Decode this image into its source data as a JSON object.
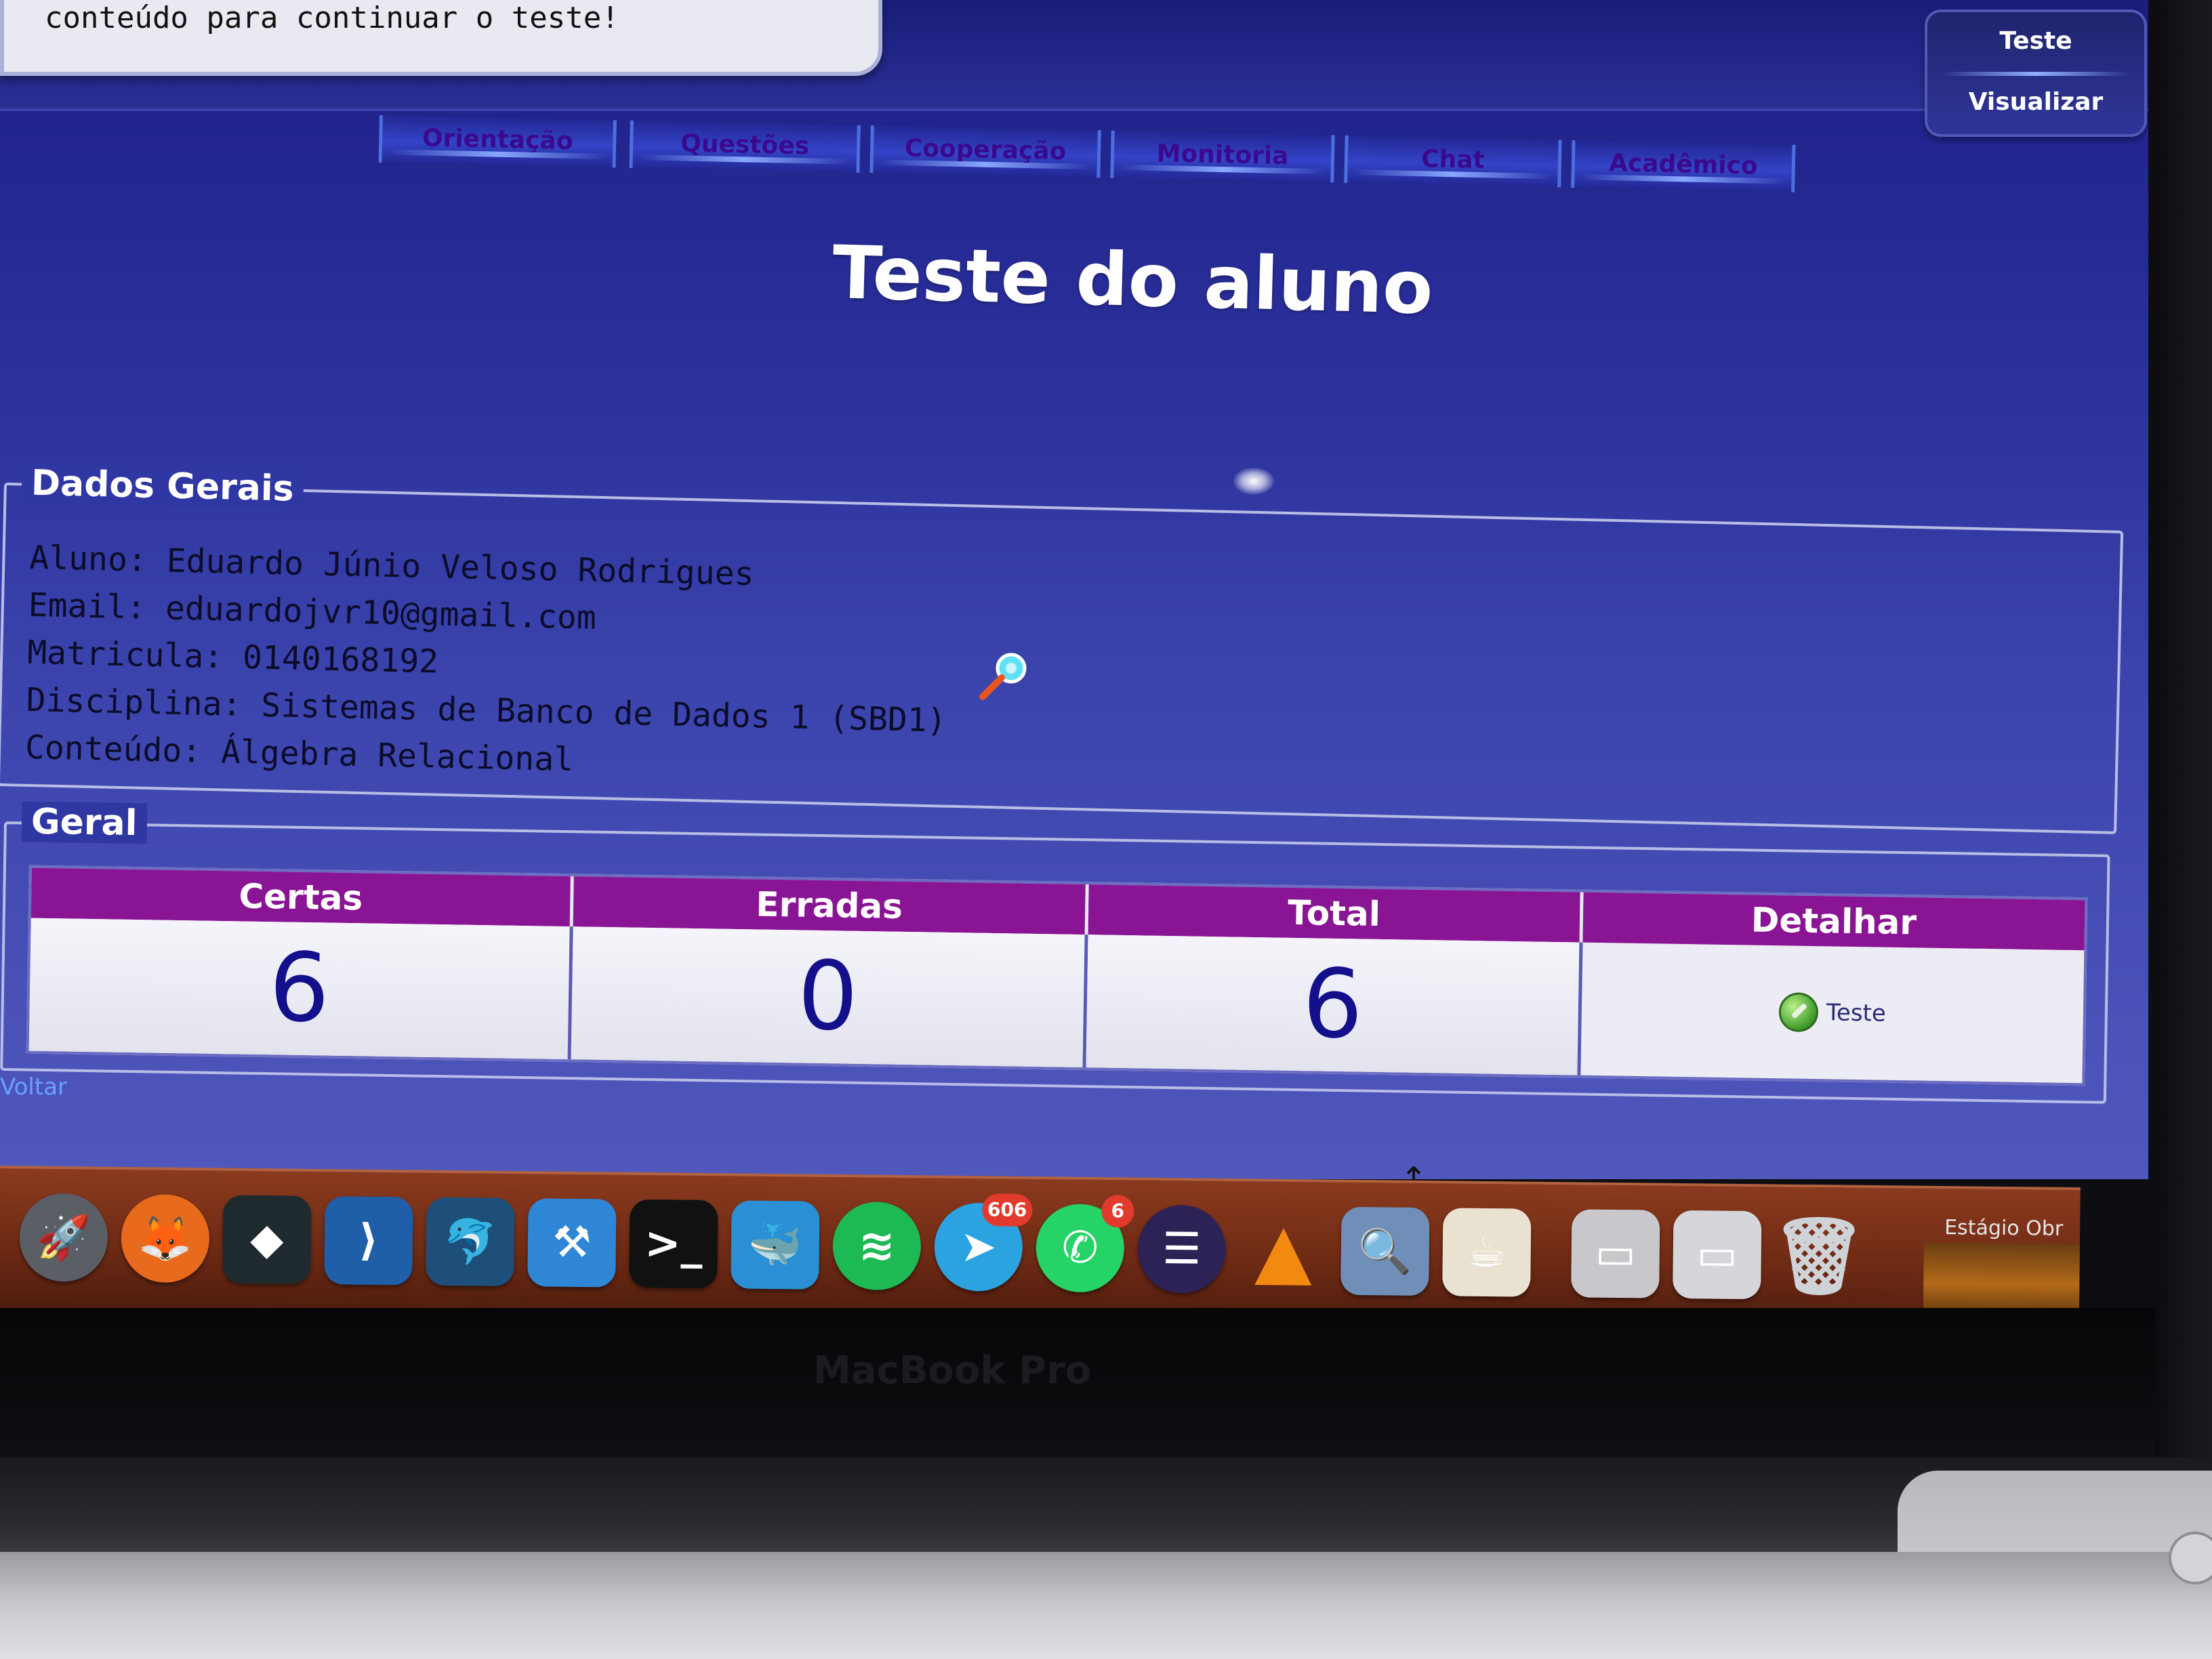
{
  "notice": {
    "text": "conteúdo para continuar o teste!"
  },
  "side_menu": {
    "item1": "Teste",
    "item2": "Visualizar"
  },
  "tabs": [
    "Orientação",
    "Questões",
    "Cooperação",
    "Monitoria",
    "Chat",
    "Acadêmico"
  ],
  "page_title": "Teste do aluno",
  "dados_gerais": {
    "legend": "Dados Gerais",
    "lines": [
      "Aluno: Eduardo Júnio Veloso Rodrigues",
      "Email: eduardojvr10@gmail.com",
      "Matricula: 0140168192",
      "Disciplina: Sistemas de Banco de Dados 1 (SBD1)",
      "Conteúdo: Álgebra Relacional"
    ]
  },
  "geral": {
    "legend": "Geral",
    "headers": [
      "Certas",
      "Erradas",
      "Total",
      "Detalhar"
    ],
    "certas": "6",
    "erradas": "0",
    "total": "6",
    "detail_link": "Teste"
  },
  "voltar": "Voltar",
  "dock": {
    "apps": [
      {
        "name": "launchpad-icon",
        "color": "#5a5f66",
        "glyph": "🚀"
      },
      {
        "name": "firefox-icon",
        "color": "#e86a1c",
        "glyph": "🦊"
      },
      {
        "name": "filmora-icon",
        "color": "#1e2a2e",
        "glyph": "◆"
      },
      {
        "name": "vscode-icon",
        "color": "#1f5fa8",
        "glyph": "⟩"
      },
      {
        "name": "mysql-workbench-icon",
        "color": "#1d4f7a",
        "glyph": "🐬"
      },
      {
        "name": "xcode-icon",
        "color": "#2f86d6",
        "glyph": "⚒"
      },
      {
        "name": "terminal-icon",
        "color": "#111111",
        "glyph": ">_"
      },
      {
        "name": "docker-icon",
        "color": "#2a8fd4",
        "glyph": "🐳"
      },
      {
        "name": "spotify-icon",
        "color": "#1db954",
        "glyph": "≋"
      },
      {
        "name": "telegram-icon",
        "color": "#2aa3e0",
        "glyph": "➤",
        "badge": "606"
      },
      {
        "name": "whatsapp-icon",
        "color": "#25d366",
        "glyph": "✆",
        "badge": "6"
      },
      {
        "name": "eclipse-icon",
        "color": "#2c2255",
        "glyph": "☰"
      },
      {
        "name": "vlc-icon",
        "color": "#f28a12",
        "glyph": "▲"
      },
      {
        "name": "preview-icon",
        "color": "#6f8fb8",
        "glyph": "🔍"
      },
      {
        "name": "java-icon",
        "color": "#e9e2d0",
        "glyph": "☕"
      },
      {
        "name": "downloads-stack-icon",
        "color": "#c8c8cc",
        "glyph": "▭"
      },
      {
        "name": "documents-stack-icon",
        "color": "#d6d6da",
        "glyph": "▭"
      },
      {
        "name": "trash-icon",
        "color": "#cfd3d8",
        "glyph": "🗑"
      }
    ],
    "window_label": "Estágio Obr"
  },
  "bezel_label": "MacBook Pro",
  "colors": {
    "page_blue": "#2a2f9a",
    "header_purple": "#8a1594",
    "value_blue": "#14108c",
    "dock_brown": "#6e2a14"
  }
}
